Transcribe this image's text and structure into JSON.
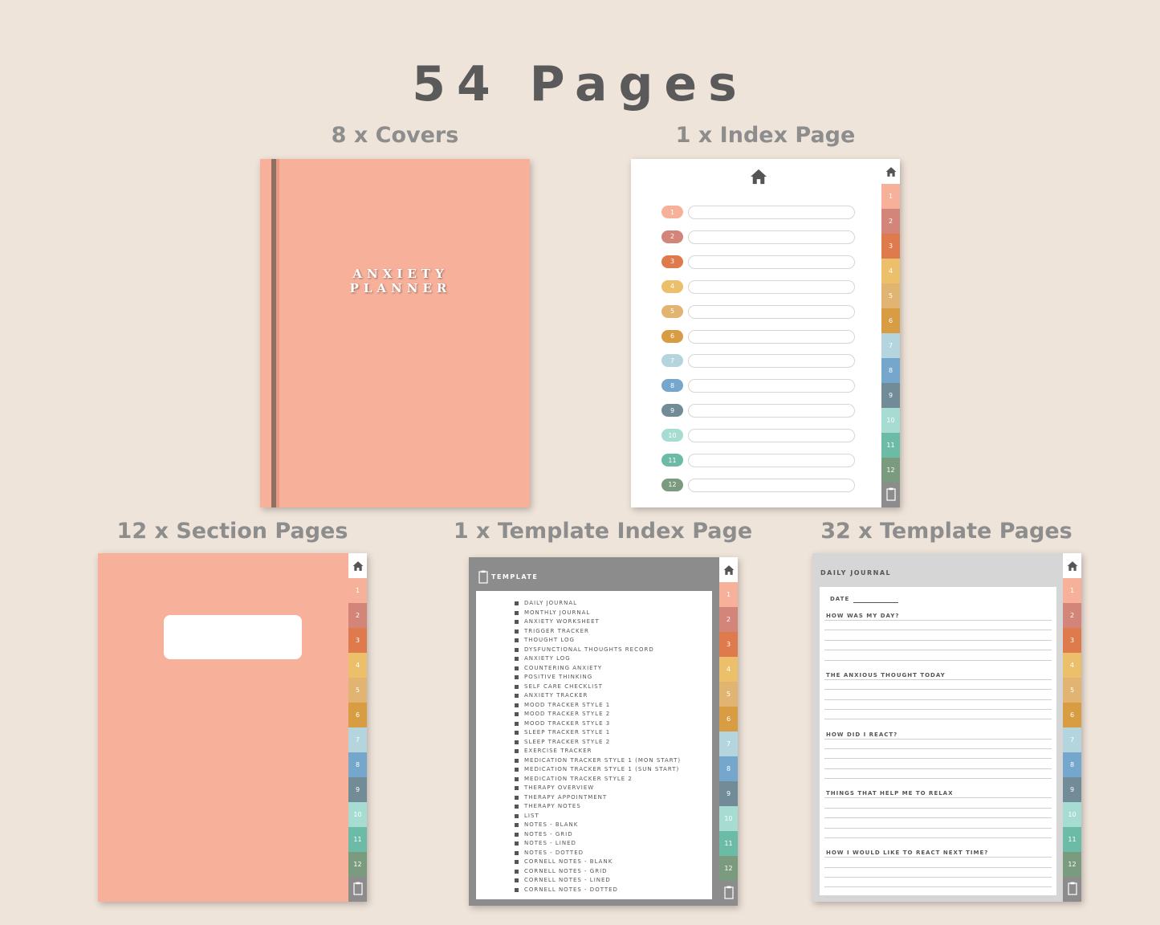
{
  "title": "54 Pages",
  "captions": {
    "covers": "8 x Covers",
    "index": "1 x Index Page",
    "sections": "12 x Section Pages",
    "template_index": "1 x Template Index Page",
    "templates": "32 x Template Pages"
  },
  "cover": {
    "title": "ANXIETY\nPLANNER",
    "color": "#f7b19b"
  },
  "tabs": [
    {
      "label": "1",
      "color": "#f7b19b"
    },
    {
      "label": "2",
      "color": "#d4857a"
    },
    {
      "label": "3",
      "color": "#df7a4c"
    },
    {
      "label": "4",
      "color": "#ecc06a"
    },
    {
      "label": "5",
      "color": "#e2b471"
    },
    {
      "label": "6",
      "color": "#d89c43"
    },
    {
      "label": "7",
      "color": "#b4d4de"
    },
    {
      "label": "8",
      "color": "#75a6cb"
    },
    {
      "label": "9",
      "color": "#728c97"
    },
    {
      "label": "10",
      "color": "#a6dcd1"
    },
    {
      "label": "11",
      "color": "#6cbba6"
    },
    {
      "label": "12",
      "color": "#7b9b7e"
    }
  ],
  "icons": {
    "home": "home-icon",
    "clipboard": "clipboard-icon"
  },
  "template_index": {
    "header": "TEMPLATE",
    "items": [
      "DAILY JOURNAL",
      "MONTHLY JOURNAL",
      "ANXIETY WORKSHEET",
      "TRIGGER TRACKER",
      "THOUGHT LOG",
      "DYSFUNCTIONAL THOUGHTS RECORD",
      "ANXIETY LOG",
      "COUNTERING ANXIETY",
      "POSITIVE THINKING",
      "SELF CARE CHECKLIST",
      "ANXIETY TRACKER",
      "MOOD TRACKER STYLE 1",
      "MOOD TRACKER STYLE 2",
      "MOOD TRACKER STYLE 3",
      "SLEEP TRACKER STYLE 1",
      "SLEEP TRACKER STYLE 2",
      "EXERCISE TRACKER",
      "MEDICATION TRACKER STYLE 1 (MON START)",
      "MEDICATION TRACKER STYLE 1 (SUN START)",
      "MEDICATION TRACKER STYLE 2",
      "THERAPY OVERVIEW",
      "THERAPY APPOINTMENT",
      "THERAPY NOTES",
      "LIST",
      "NOTES - BLANK",
      "NOTES - GRID",
      "NOTES - LINED",
      "NOTES - DOTTED",
      "CORNELL NOTES - BLANK",
      "CORNELL NOTES - GRID",
      "CORNELL NOTES - LINED",
      "CORNELL NOTES - DOTTED"
    ]
  },
  "daily_journal": {
    "header": "DAILY JOURNAL",
    "date_label": "DATE",
    "questions": [
      "HOW WAS MY DAY?",
      "THE ANXIOUS THOUGHT TODAY",
      "HOW DID I REACT?",
      "THINGS THAT HELP ME TO RELAX",
      "HOW I WOULD LIKE TO REACT NEXT TIME?"
    ]
  }
}
